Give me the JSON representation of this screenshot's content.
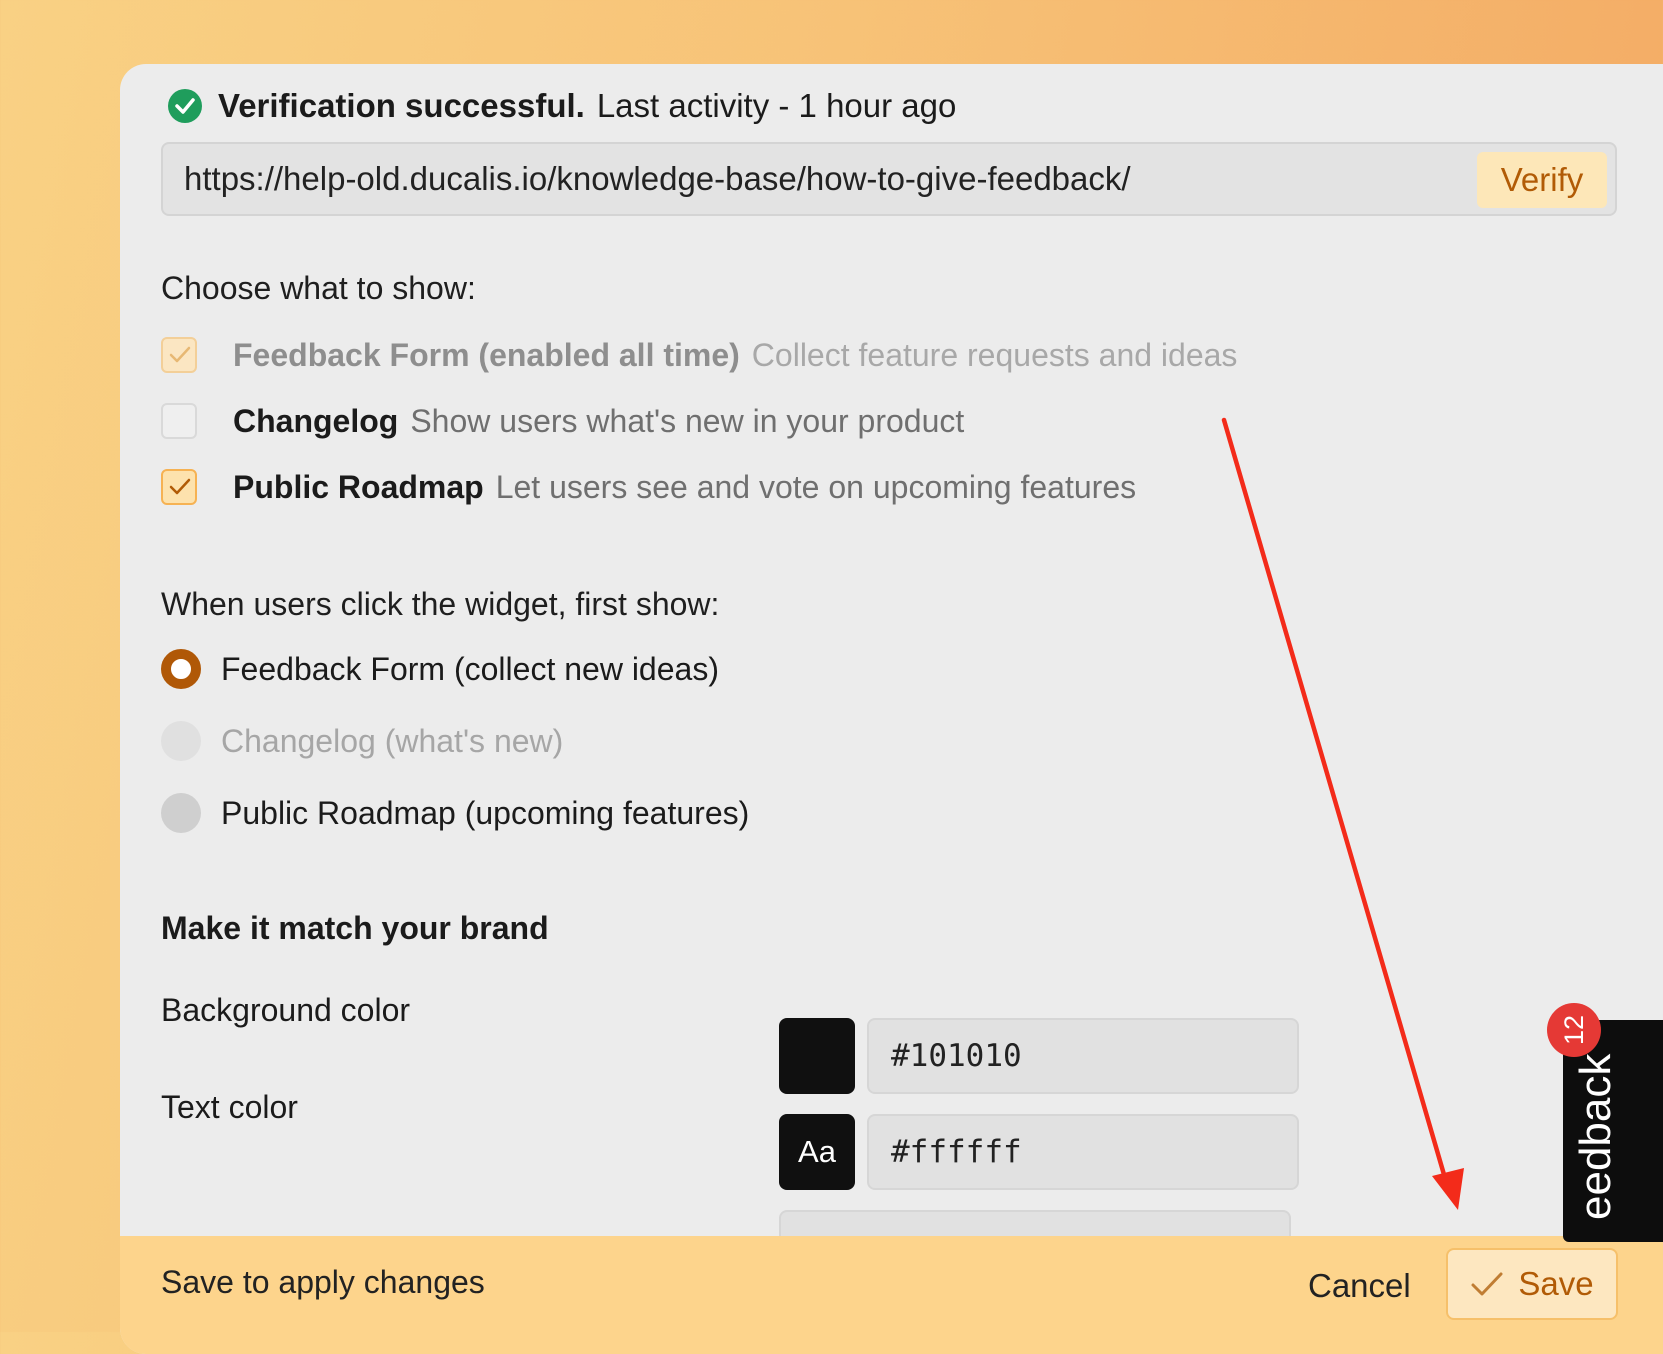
{
  "verification": {
    "status": "Verification successful.",
    "activity": "Last activity - 1 hour ago"
  },
  "url_field": {
    "value": "https://help-old.ducalis.io/knowledge-base/how-to-give-feedback/",
    "verify_label": "Verify"
  },
  "show_options": {
    "heading": "Choose what to show:",
    "items": [
      {
        "title": "Feedback Form (enabled all time)",
        "desc": "Collect feature requests and ideas",
        "checked": true,
        "disabled": true
      },
      {
        "title": "Changelog",
        "desc": "Show users what's new in your product",
        "checked": false,
        "disabled": false
      },
      {
        "title": "Public Roadmap",
        "desc": "Let users see and vote on upcoming features",
        "checked": true,
        "disabled": false
      }
    ]
  },
  "first_show": {
    "heading": "When users click the widget, first show:",
    "options": [
      {
        "label": "Feedback Form (collect new ideas)",
        "selected": true,
        "disabled": false
      },
      {
        "label": "Changelog (what's new)",
        "selected": false,
        "disabled": true
      },
      {
        "label": "Public Roadmap (upcoming features)",
        "selected": false,
        "disabled": false
      }
    ]
  },
  "brand": {
    "heading": "Make it match your brand",
    "background": {
      "label": "Background color",
      "value": "#101010"
    },
    "text": {
      "label": "Text color",
      "value": "#ffffff",
      "swatch_label": "Aa"
    }
  },
  "footer": {
    "message": "Save to apply changes",
    "cancel_label": "Cancel",
    "save_label": "Save"
  },
  "widget_tab": {
    "label": "eedback",
    "badge_count": "12"
  },
  "colors": {
    "accent": "#b15b06",
    "success": "#1f9d5c",
    "annotation_arrow": "#f32b1a"
  }
}
